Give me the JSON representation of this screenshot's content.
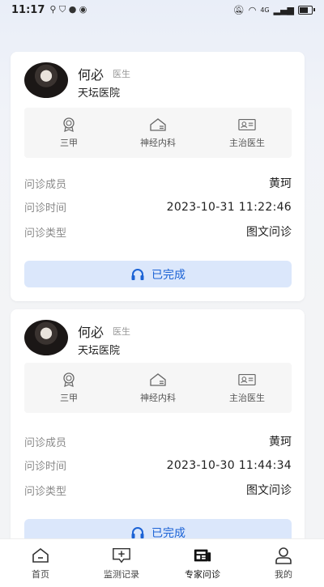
{
  "status_bar": {
    "time": "11:17",
    "network": "4G"
  },
  "consultations": [
    {
      "doctor_name": "何必",
      "doctor_title": "医生",
      "hospital": "天坛医院",
      "tags": [
        {
          "icon": "medal-icon",
          "label": "三甲"
        },
        {
          "icon": "home-department-icon",
          "label": "神经内科"
        },
        {
          "icon": "id-card-icon",
          "label": "主治医生"
        }
      ],
      "member_label": "问诊成员",
      "member_value": "黄珂",
      "time_label": "问诊时间",
      "time_value": "2023-10-31 11:22:46",
      "type_label": "问诊类型",
      "type_value": "图文问诊",
      "status_label": "已完成"
    },
    {
      "doctor_name": "何必",
      "doctor_title": "医生",
      "hospital": "天坛医院",
      "tags": [
        {
          "icon": "medal-icon",
          "label": "三甲"
        },
        {
          "icon": "home-department-icon",
          "label": "神经内科"
        },
        {
          "icon": "id-card-icon",
          "label": "主治医生"
        }
      ],
      "member_label": "问诊成员",
      "member_value": "黄珂",
      "time_label": "问诊时间",
      "time_value": "2023-10-30 11:44:34",
      "type_label": "问诊类型",
      "type_value": "图文问诊",
      "status_label": "已完成"
    }
  ],
  "tabbar": {
    "active": "专家问诊",
    "items": [
      {
        "icon": "home-icon",
        "label": "首页"
      },
      {
        "icon": "monitor-record-icon",
        "label": "监测记录"
      },
      {
        "icon": "expert-consult-icon",
        "label": "专家问诊"
      },
      {
        "icon": "profile-icon",
        "label": "我的"
      }
    ]
  },
  "colors": {
    "accent": "#1c63d5",
    "button_bg": "#dbe7fb"
  }
}
